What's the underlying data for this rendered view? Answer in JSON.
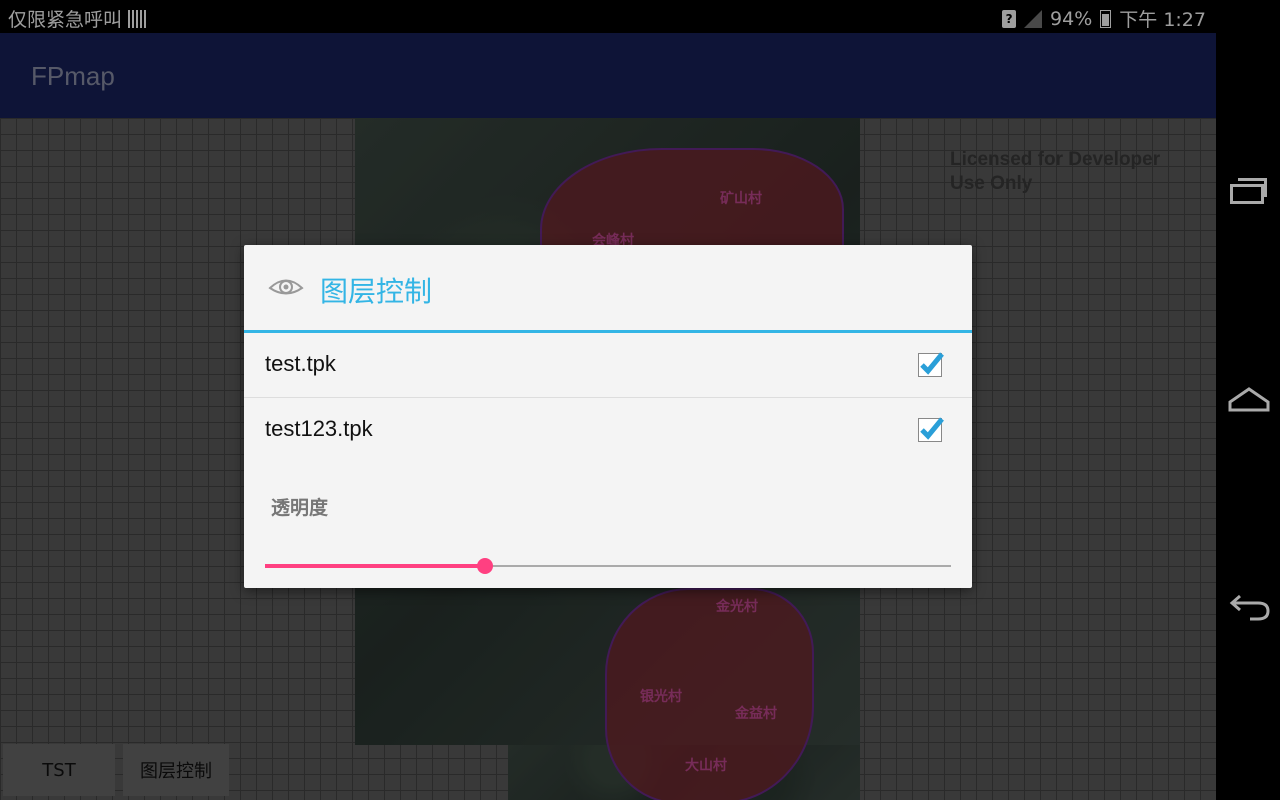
{
  "status_bar": {
    "notification_text": "仅限紧急呼叫",
    "sim_label": "?",
    "battery": "94%",
    "time": "下午 1:27"
  },
  "app_bar": {
    "title": "FPmap"
  },
  "map": {
    "watermark_line1": "Licensed for Developer",
    "watermark_line2": "Use Only",
    "villages": [
      "矿山村",
      "会峰村",
      "金光村",
      "银光村",
      "金益村",
      "大山村"
    ],
    "buttons": {
      "tst": "TST",
      "layer_control": "图层控制"
    }
  },
  "dialog": {
    "title": "图层控制",
    "layers": [
      {
        "name": "test.tpk",
        "checked": true
      },
      {
        "name": "test123.tpk",
        "checked": true
      }
    ],
    "opacity_label": "透明度",
    "opacity_value": 0.32
  },
  "colors": {
    "accent": "#33b5e5",
    "slider": "#ff4081",
    "app_bar": "#17215a"
  }
}
